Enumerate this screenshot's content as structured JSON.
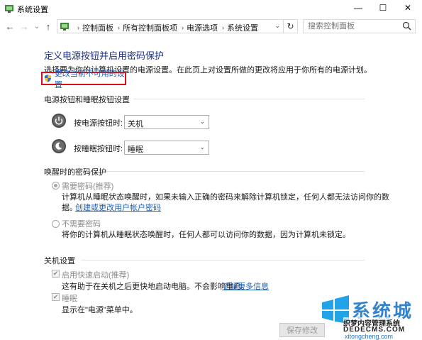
{
  "window": {
    "title": "系统设置",
    "controls": {
      "minimize": "—",
      "maximize": "☐",
      "close": "✕"
    }
  },
  "nav": {
    "back": "←",
    "forward": "→",
    "recent": "⌄",
    "up": "↑",
    "breadcrumbs": [
      "控制面板",
      "所有控制面板项",
      "电源选项",
      "系统设置"
    ],
    "separator": "›",
    "dropdown": "⌄",
    "refresh": "↻",
    "search_placeholder": "搜索控制面板"
  },
  "page": {
    "title": "定义电源按钮并启用密码保护",
    "description": "选择要为你的计算机设置的电源设置。在此页上对设置所做的更改将应用于你所有的电源计划。",
    "change_link": "更改当前不可用的设置"
  },
  "power_section": {
    "title": "电源按钮和睡眠按钮设置",
    "power_label": "按电源按钮时:",
    "power_value": "关机",
    "sleep_label": "按睡眠按钮时:",
    "sleep_value": "睡眠"
  },
  "password_section": {
    "title": "唤醒时的密码保护",
    "require_label": "需要密码(推荐)",
    "require_desc": "计算机从睡眠状态唤醒时，如果未输入正确的密码来解除计算机锁定，任何人都无法访问你的数",
    "require_desc2": "据。",
    "require_link": "创建或更改用户帐户密码",
    "no_require_label": "不需要密码",
    "no_require_desc": "将你的计算机从睡眠状态唤醒时，任何人都可以访问你的数据，因为计算机未锁定。"
  },
  "shutdown_section": {
    "title": "关机设置",
    "fast_label": "启用快速启动(推荐)",
    "fast_desc": "这有助于在关机之后更快地启动电脑。不会影响重启。",
    "fast_link": "了解更多信息",
    "sleep_label": "睡眠",
    "sleep_desc": "显示在\"电源\"菜单中。"
  },
  "footer": {
    "save": "保存修改"
  },
  "watermark": {
    "big": "系统城",
    "line1": "织梦内容管理系统",
    "line2": "DEDECMS.COM",
    "line3": "xitongcheng.com"
  },
  "colors": {
    "title_blue": "#1e3287",
    "link_blue": "#1a5fb4",
    "highlight_red": "#d4121d"
  }
}
